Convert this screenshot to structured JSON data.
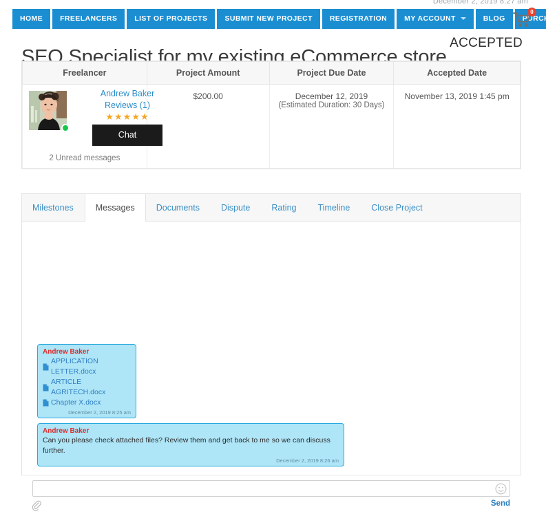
{
  "topbar": {
    "datetime": "December 2, 2019 8:27 am"
  },
  "nav": {
    "items": [
      {
        "label": "HOME",
        "has_caret": false
      },
      {
        "label": "FREELANCERS",
        "has_caret": false
      },
      {
        "label": "LIST OF PROJECTS",
        "has_caret": false
      },
      {
        "label": "SUBMIT NEW PROJECT",
        "has_caret": false
      },
      {
        "label": "REGISTRATION",
        "has_caret": false
      },
      {
        "label": "MY ACCOUNT",
        "has_caret": true
      },
      {
        "label": "BLOG",
        "has_caret": false
      },
      {
        "label": "PURCHASE PLUGIN",
        "has_caret": false
      }
    ],
    "cart_count": "0",
    "accent_color": "#1b8ed2",
    "badge_color": "#e8432e"
  },
  "header": {
    "title": "SEO Specialist for my existing eCommerce store",
    "status": "ACCEPTED"
  },
  "info_table": {
    "columns": [
      "Freelancer",
      "Project Amount",
      "Project Due Date",
      "Accepted Date"
    ],
    "row": {
      "freelancer_name": "Andrew Baker",
      "reviews_label": "Reviews (1)",
      "stars": "★★★★★",
      "rating_value": 5,
      "star_color": "#f5a623",
      "chat_button": "Chat",
      "unread_messages": "2 Unread messages",
      "online": true,
      "project_amount": "$200.00",
      "project_due_date": "December 12, 2019",
      "estimated_duration": "(Estimated Duration: 30 Days)",
      "accepted_date": "November 13, 2019 1:45 pm"
    }
  },
  "tabs": [
    {
      "label": "Milestones",
      "active": false
    },
    {
      "label": "Messages",
      "active": true
    },
    {
      "label": "Documents",
      "active": false
    },
    {
      "label": "Dispute",
      "active": false
    },
    {
      "label": "Rating",
      "active": false
    },
    {
      "label": "Timeline",
      "active": false
    },
    {
      "label": "Close Project",
      "active": false
    }
  ],
  "messages": [
    {
      "sender": "Andrew Baker",
      "type": "files",
      "files": [
        "APPLICATION LETTER.docx",
        "ARTICLE AGRITECH.docx",
        "Chapter X.docx"
      ],
      "timestamp": "December 2, 2019 8:25 am"
    },
    {
      "sender": "Andrew Baker",
      "type": "text",
      "text": "Can you please check attached files? Review them and get back to me so we can discuss further.",
      "timestamp": "December 2, 2019 8:26 am"
    }
  ],
  "composer": {
    "value": "",
    "placeholder": "",
    "send_label": "Send"
  },
  "icons": {
    "cart": "shopping-cart-icon",
    "emoji": "emoji-smiley-icon",
    "attach": "paperclip-icon",
    "file": "file-document-icon",
    "caret": "chevron-down-icon"
  }
}
